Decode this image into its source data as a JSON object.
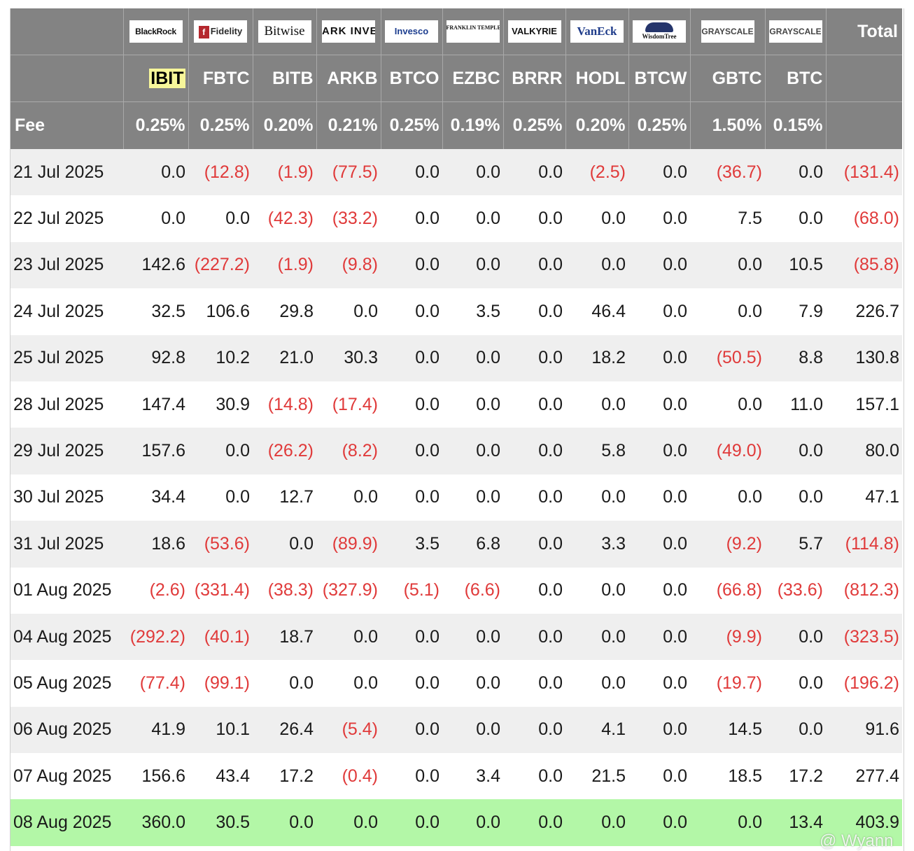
{
  "logos": {
    "IBIT": "BlackRock",
    "FBTC": "Fidelity",
    "BITB": "Bitwise",
    "ARKB": "ARK INVEST",
    "BTCO": "Invesco",
    "EZBC": "FRANKLIN TEMPLETON",
    "BRRR": "VALKYRIE",
    "HODL": "VanEck",
    "BTCW": "WisdomTree",
    "GBTC": "GRAYSCALE",
    "BTC": "GRAYSCALE"
  },
  "total_label": "Total",
  "fee_label": "Fee",
  "tickers": [
    "IBIT",
    "FBTC",
    "BITB",
    "ARKB",
    "BTCO",
    "EZBC",
    "BRRR",
    "HODL",
    "BTCW",
    "GBTC",
    "BTC"
  ],
  "fees": [
    "0.25%",
    "0.25%",
    "0.20%",
    "0.21%",
    "0.25%",
    "0.19%",
    "0.25%",
    "0.20%",
    "0.25%",
    "1.50%",
    "0.15%"
  ],
  "rows": [
    {
      "date": "21 Jul 2025",
      "values": [
        "0.0",
        "(12.8)",
        "(1.9)",
        "(77.5)",
        "0.0",
        "0.0",
        "0.0",
        "(2.5)",
        "0.0",
        "(36.7)",
        "0.0",
        "(131.4)"
      ]
    },
    {
      "date": "22 Jul 2025",
      "values": [
        "0.0",
        "0.0",
        "(42.3)",
        "(33.2)",
        "0.0",
        "0.0",
        "0.0",
        "0.0",
        "0.0",
        "7.5",
        "0.0",
        "(68.0)"
      ]
    },
    {
      "date": "23 Jul 2025",
      "values": [
        "142.6",
        "(227.2)",
        "(1.9)",
        "(9.8)",
        "0.0",
        "0.0",
        "0.0",
        "0.0",
        "0.0",
        "0.0",
        "10.5",
        "(85.8)"
      ]
    },
    {
      "date": "24 Jul 2025",
      "values": [
        "32.5",
        "106.6",
        "29.8",
        "0.0",
        "0.0",
        "3.5",
        "0.0",
        "46.4",
        "0.0",
        "0.0",
        "7.9",
        "226.7"
      ]
    },
    {
      "date": "25 Jul 2025",
      "values": [
        "92.8",
        "10.2",
        "21.0",
        "30.3",
        "0.0",
        "0.0",
        "0.0",
        "18.2",
        "0.0",
        "(50.5)",
        "8.8",
        "130.8"
      ]
    },
    {
      "date": "28 Jul 2025",
      "values": [
        "147.4",
        "30.9",
        "(14.8)",
        "(17.4)",
        "0.0",
        "0.0",
        "0.0",
        "0.0",
        "0.0",
        "0.0",
        "11.0",
        "157.1"
      ]
    },
    {
      "date": "29 Jul 2025",
      "values": [
        "157.6",
        "0.0",
        "(26.2)",
        "(8.2)",
        "0.0",
        "0.0",
        "0.0",
        "5.8",
        "0.0",
        "(49.0)",
        "0.0",
        "80.0"
      ]
    },
    {
      "date": "30 Jul 2025",
      "values": [
        "34.4",
        "0.0",
        "12.7",
        "0.0",
        "0.0",
        "0.0",
        "0.0",
        "0.0",
        "0.0",
        "0.0",
        "0.0",
        "47.1"
      ]
    },
    {
      "date": "31 Jul 2025",
      "values": [
        "18.6",
        "(53.6)",
        "0.0",
        "(89.9)",
        "3.5",
        "6.8",
        "0.0",
        "3.3",
        "0.0",
        "(9.2)",
        "5.7",
        "(114.8)"
      ]
    },
    {
      "date": "01 Aug 2025",
      "values": [
        "(2.6)",
        "(331.4)",
        "(38.3)",
        "(327.9)",
        "(5.1)",
        "(6.6)",
        "0.0",
        "0.0",
        "0.0",
        "(66.8)",
        "(33.6)",
        "(812.3)"
      ]
    },
    {
      "date": "04 Aug 2025",
      "values": [
        "(292.2)",
        "(40.1)",
        "18.7",
        "0.0",
        "0.0",
        "0.0",
        "0.0",
        "0.0",
        "0.0",
        "(9.9)",
        "0.0",
        "(323.5)"
      ]
    },
    {
      "date": "05 Aug 2025",
      "values": [
        "(77.4)",
        "(99.1)",
        "0.0",
        "0.0",
        "0.0",
        "0.0",
        "0.0",
        "0.0",
        "0.0",
        "(19.7)",
        "0.0",
        "(196.2)"
      ]
    },
    {
      "date": "06 Aug 2025",
      "values": [
        "41.9",
        "10.1",
        "26.4",
        "(5.4)",
        "0.0",
        "0.0",
        "0.0",
        "4.1",
        "0.0",
        "14.5",
        "0.0",
        "91.6"
      ]
    },
    {
      "date": "07 Aug 2025",
      "values": [
        "156.6",
        "43.4",
        "17.2",
        "(0.4)",
        "0.0",
        "3.4",
        "0.0",
        "21.5",
        "0.0",
        "18.5",
        "17.2",
        "277.4"
      ]
    },
    {
      "date": "08 Aug 2025",
      "values": [
        "360.0",
        "30.5",
        "0.0",
        "0.0",
        "0.0",
        "0.0",
        "0.0",
        "0.0",
        "0.0",
        "0.0",
        "13.4",
        "403.9"
      ]
    }
  ],
  "highlight_row": 14,
  "colors": {
    "header": "#838383",
    "negative": "#e03a3a",
    "highlight_row": "#b3f7a7",
    "highlight_ticker": "#f7f69a",
    "alt_row": "#efefef"
  },
  "watermark": "@ Wyann"
}
